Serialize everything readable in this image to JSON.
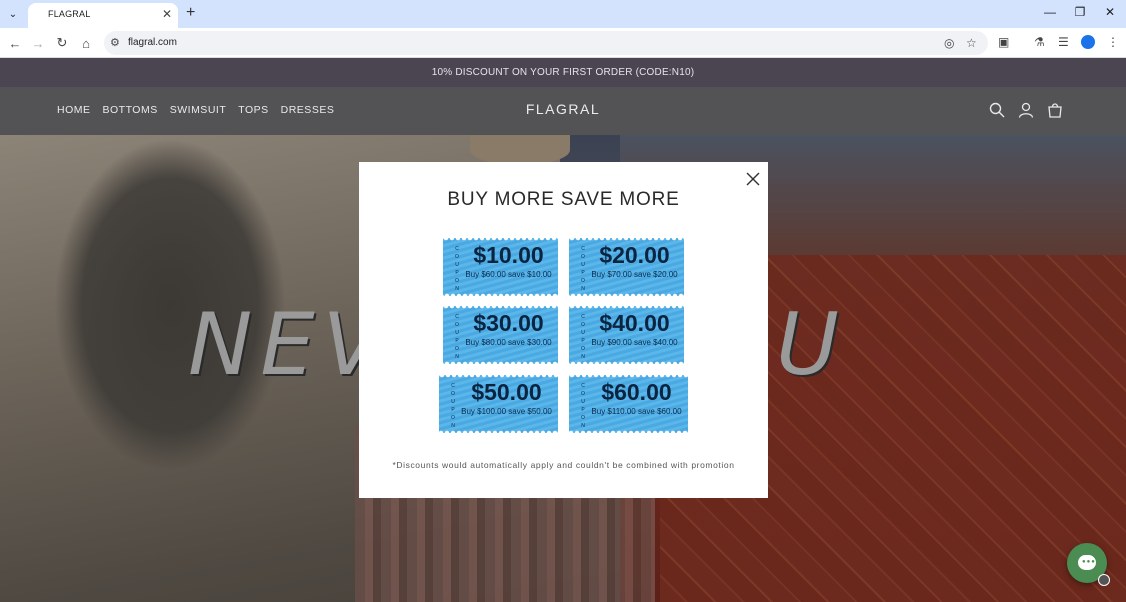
{
  "browser": {
    "tab_title": "FLAGRAL",
    "url": "flagral.com"
  },
  "announcement": "10% DISCOUNT ON YOUR FIRST ORDER (CODE:N10)",
  "header": {
    "nav": [
      "HOME",
      "BOTTOMS",
      "SWIMSUIT",
      "TOPS",
      "DRESSES"
    ],
    "logo": "FLAGRAL"
  },
  "hero": {
    "text_left": "NEV",
    "text_right": "U"
  },
  "modal": {
    "title": "BUY MORE SAVE MORE",
    "coupon_side_label": "COUPON",
    "coupons": [
      {
        "amount": "$10.00",
        "desc": "Buy $60.00 save $10.00"
      },
      {
        "amount": "$20.00",
        "desc": "Buy $70.00 save $20.00"
      },
      {
        "amount": "$30.00",
        "desc": "Buy $80.00 save $30.00"
      },
      {
        "amount": "$40.00",
        "desc": "Buy $90.00 save $40.00"
      },
      {
        "amount": "$50.00",
        "desc": "Buy $100.00 save $50.00"
      },
      {
        "amount": "$60.00",
        "desc": "Buy $110.00 save $60.00"
      }
    ],
    "note": "*Discounts would automatically apply and couldn't be combined with promotion"
  },
  "colors": {
    "coupon_blue": "#5bb6ea",
    "announcement_bg": "#4a4550",
    "chat_green": "#4b8c52"
  },
  "icons": [
    "search-icon",
    "account-icon",
    "cart-icon",
    "close-icon",
    "chat-icon"
  ]
}
